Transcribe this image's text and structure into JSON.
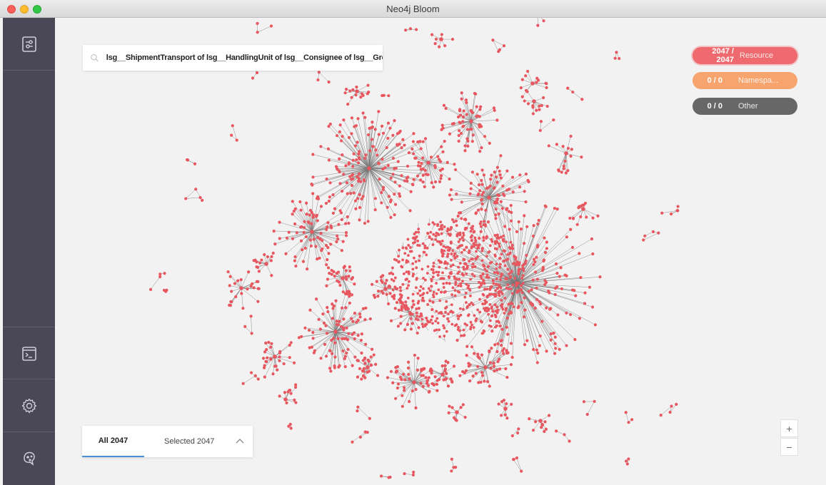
{
  "window": {
    "title": "Neo4j Bloom"
  },
  "sidebar": {
    "items": [
      {
        "icon": "filter-settings-icon"
      },
      {
        "icon": "terminal-icon"
      },
      {
        "icon": "gear-icon"
      },
      {
        "icon": "bloom-logo-icon"
      }
    ]
  },
  "search": {
    "value": "lsg__ShipmentTransport of lsg__HandlingUnit of lsg__Consignee of lsg__GreaterCh",
    "icon": "search-icon"
  },
  "legend": [
    {
      "count": "2047 / 2047",
      "label": "Resource",
      "color": "#ef6a6e"
    },
    {
      "count": "0 / 0",
      "label": "Namespa...",
      "color": "#f7a46e"
    },
    {
      "count": "0 / 0",
      "label": "Other",
      "color": "#676767"
    }
  ],
  "drawer": {
    "all_label": "All 2047",
    "selected_label": "Selected 2047"
  },
  "zoom": {
    "in_label": "+",
    "out_label": "−"
  },
  "graph": {
    "node_color": "#e8575f",
    "edge_color": "#777777",
    "node_count": 2047
  }
}
